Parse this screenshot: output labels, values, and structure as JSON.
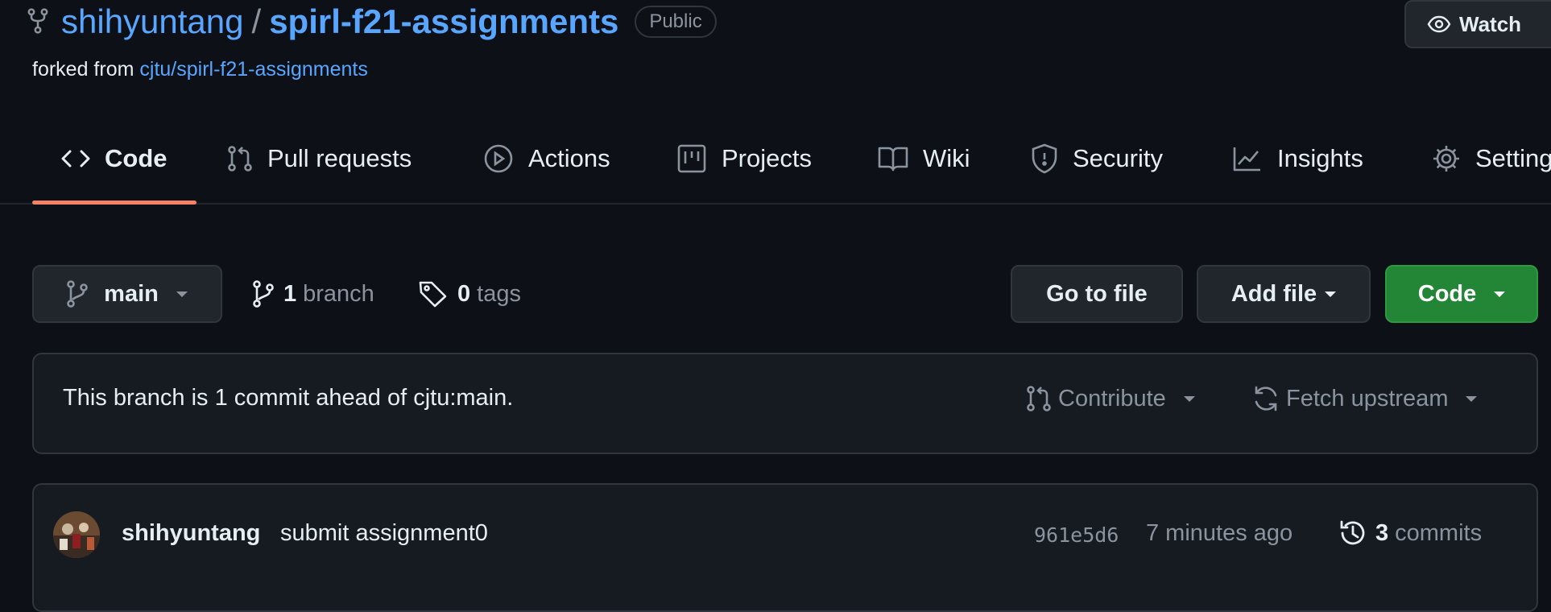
{
  "header": {
    "owner": "shihyuntang",
    "separator": "/",
    "repo": "spirl-f21-assignments",
    "visibility": "Public",
    "forked_prefix": "forked from",
    "forked_source": "cjtu/spirl-f21-assignments",
    "watch_label": "Watch"
  },
  "nav": {
    "tabs": [
      {
        "label": "Code",
        "icon": "code-icon"
      },
      {
        "label": "Pull requests",
        "icon": "pull-request-icon"
      },
      {
        "label": "Actions",
        "icon": "play-icon"
      },
      {
        "label": "Projects",
        "icon": "project-icon"
      },
      {
        "label": "Wiki",
        "icon": "book-icon"
      },
      {
        "label": "Security",
        "icon": "shield-icon"
      },
      {
        "label": "Insights",
        "icon": "graph-icon"
      },
      {
        "label": "Settings",
        "icon": "gear-icon"
      }
    ],
    "active": "Code"
  },
  "toolbar": {
    "branch": "main",
    "branch_count": "1",
    "branch_word": "branch",
    "tag_count": "0",
    "tag_word": "tags",
    "go_to_file": "Go to file",
    "add_file": "Add file",
    "code": "Code"
  },
  "ahead": {
    "message": "This branch is 1 commit ahead of cjtu:main.",
    "contribute": "Contribute",
    "fetch_upstream": "Fetch upstream"
  },
  "commit": {
    "author": "shihyuntang",
    "message": "submit assignment0",
    "sha": "961e5d6",
    "time": "7 minutes ago",
    "count": "3",
    "count_word": "commits"
  },
  "colors": {
    "background": "#0d1117",
    "link": "#58a6ff",
    "active_tab_underline": "#f78166",
    "code_button": "#238636"
  }
}
